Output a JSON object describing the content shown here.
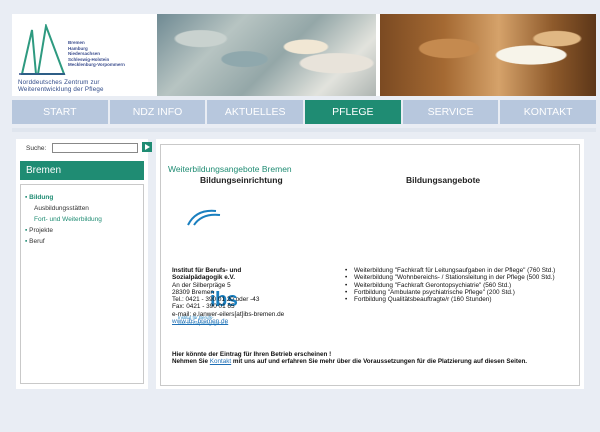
{
  "header": {
    "logo_states": [
      "Bremen",
      "Hamburg",
      "Niedersachsen",
      "Schleswig-Holstein",
      "Mecklenburg-Vorpommern"
    ],
    "logo_name_line1": "Norddeutsches Zentrum zur",
    "logo_name_line2": "Weiterentwicklung der Pflege"
  },
  "nav": {
    "items": [
      "START",
      "NDZ INFO",
      "AKTUELLES",
      "PFLEGE",
      "SERVICE",
      "KONTAKT"
    ],
    "active": "PFLEGE"
  },
  "sidebar": {
    "search_label": "Suche:",
    "search_value": "",
    "region": "Bremen",
    "menu": {
      "bildung": "Bildung",
      "ausbildung": "Ausbildungsstätten",
      "fort": "Fort- und Weiterbildung",
      "projekte": "Projekte",
      "beruf": "Beruf"
    }
  },
  "content": {
    "title": "Weiterbildungsangebote Bremen",
    "col1": "Bildungseinrichtung",
    "col2": "Bildungsangebote",
    "ibs_text": "ibs",
    "ibs_sub1": "Institut für Berufs-",
    "ibs_sub2": "und Sozialpädagogik e.V.",
    "addr": {
      "name1": "Institut für Berufs- und",
      "name2": "Sozialpädagogik e.V.",
      "street": "An der Silberpräge 5",
      "city": "28309 Bremen",
      "tel": "Tel.: 0421 - 390 01 20 oder -43",
      "fax": "Fax: 0421 - 390 01 65",
      "email": "e-mail: e.lanwer-eilers[at]ibs-bremen.de",
      "web": "www.ibs-bremen.de"
    },
    "offers": [
      "Weiterbildung \"Fachkraft für Leitungsaufgaben in der Pflege\" (760 Std.)",
      "Weiterbildung \"Wohnbereichs- / Stationsleitung in der Pflege (500 Std.)",
      "Weiterbildung \"Fachkraft Gerontopsychiatrie\" (560 Std.)",
      "Fortbildung \"Ambulante psychiatrische Pflege\" (200 Std.)",
      "Fortbildung Qualitätsbeauftragte/r (160 Stunden)"
    ],
    "note_line1": "Hier könnte der Eintrag für Ihren Betrieb erscheinen !",
    "note_pre": "Nehmen Sie ",
    "note_link": "Kontakt",
    "note_post": " mit uns auf und erfahren Sie mehr über die Voraussetzungen für die Platzierung auf diesen Seiten."
  },
  "colors": {
    "accent": "#1f8c73",
    "nav_bg": "#b7c7dd",
    "page_bg": "#e9edf4",
    "link": "#1f6fb5"
  }
}
